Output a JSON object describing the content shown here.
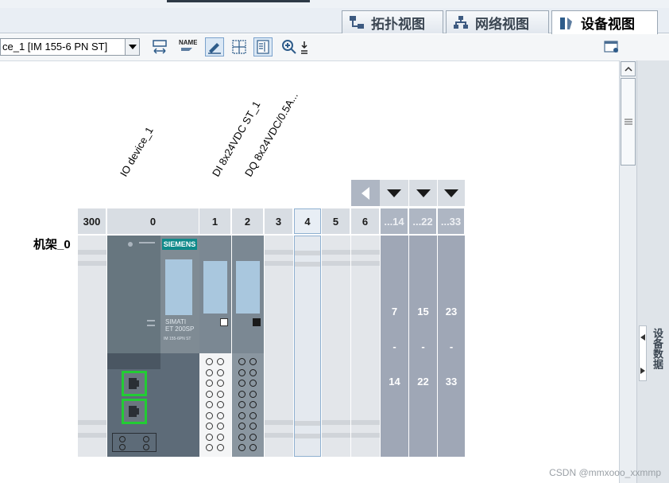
{
  "tabs": [
    {
      "label": "拓扑视图",
      "active": false,
      "icon": "topology-icon"
    },
    {
      "label": "网络视图",
      "active": false,
      "icon": "network-icon"
    },
    {
      "label": "设备视图",
      "active": true,
      "icon": "device-icon"
    }
  ],
  "toolbar": {
    "device_select_value": "ce_1 [IM 155-6 PN ST]",
    "name_icon_text": "NAME"
  },
  "rack": {
    "name": "机架_0",
    "slot_labels": [
      "300",
      "0",
      "1",
      "2",
      "3",
      "4",
      "5",
      "6",
      "...14",
      "...22",
      "...33"
    ],
    "device_labels": [
      "IO device_1",
      "DI 8x24VDC ST_1",
      "DQ 8x24VDC/0.5A..."
    ],
    "groups": [
      {
        "from": "7",
        "dash": "-",
        "to": "14"
      },
      {
        "from": "15",
        "dash": "-",
        "to": "22"
      },
      {
        "from": "23",
        "dash": "-",
        "to": "33"
      }
    ],
    "module_brand": "SIEMENS",
    "module_model": "SIMATI\nET 200SP",
    "module_sub": "IM 155-6PN ST"
  },
  "side_panel": {
    "label": "设备数据"
  },
  "watermark": "CSDN @mmxooo_xxmmp",
  "colors": {
    "accent": "#2f7fb8",
    "rack_dark": "#5d6b78",
    "green_port": "#22cc33",
    "group_col": "#9fa7b6"
  }
}
